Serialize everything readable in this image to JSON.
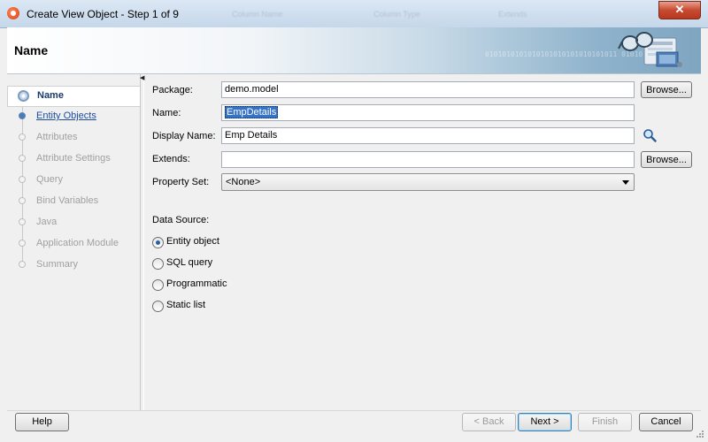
{
  "window": {
    "title": "Create View Object - Step 1 of 9",
    "faint_titles": [
      "Column Name",
      "Column Type",
      "Extends"
    ],
    "close_label": "✕"
  },
  "header": {
    "title": "Name",
    "binary_text": "0101010101010101010101010101011\n0101010101010"
  },
  "nav": {
    "items": [
      {
        "label": "Name",
        "state": "active"
      },
      {
        "label": "Entity Objects",
        "state": "link"
      },
      {
        "label": "Attributes",
        "state": "disabled"
      },
      {
        "label": "Attribute Settings",
        "state": "disabled"
      },
      {
        "label": "Query",
        "state": "disabled"
      },
      {
        "label": "Bind Variables",
        "state": "disabled"
      },
      {
        "label": "Java",
        "state": "disabled"
      },
      {
        "label": "Application Module",
        "state": "disabled"
      },
      {
        "label": "Summary",
        "state": "disabled"
      }
    ]
  },
  "form": {
    "package": {
      "label": "Package:",
      "value": "demo.model",
      "browse": "Browse..."
    },
    "name": {
      "label": "Name:",
      "value": "EmpDetails"
    },
    "display_name": {
      "label": "Display Name:",
      "value": "Emp Details"
    },
    "extends": {
      "label": "Extends:",
      "value": "",
      "browse": "Browse..."
    },
    "property_set": {
      "label": "Property Set:",
      "value": "<None>"
    },
    "data_source": {
      "label": "Data Source:",
      "options": [
        {
          "label": "Entity object",
          "selected": true
        },
        {
          "label": "SQL query",
          "selected": false
        },
        {
          "label": "Programmatic",
          "selected": false
        },
        {
          "label": "Static list",
          "selected": false
        }
      ]
    }
  },
  "footer": {
    "help": "Help",
    "back": "< Back",
    "next": "Next >",
    "finish": "Finish",
    "cancel": "Cancel"
  },
  "colors": {
    "accent": "#3473c7",
    "link": "#1d4c9c",
    "close": "#c74a30"
  }
}
